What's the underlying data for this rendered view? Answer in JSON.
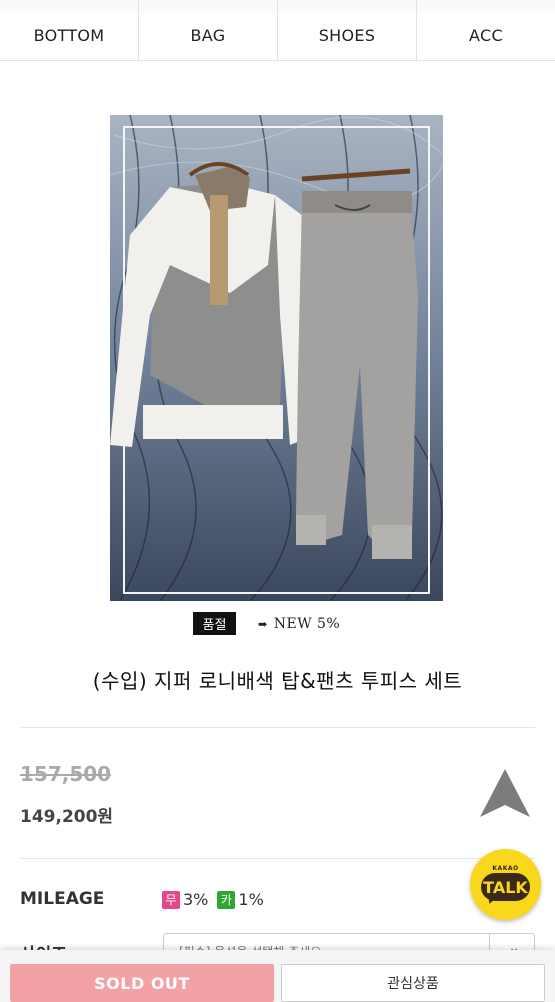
{
  "nav": {
    "items": [
      "BOTTOM",
      "BAG",
      "SHOES",
      "ACC"
    ]
  },
  "product": {
    "badge_soldout": "품절",
    "badge_new": "NEW 5%",
    "title": "(수입) 지퍼 로니배색 탑&팬츠 투피스 세트",
    "original_price": "157,500",
    "price": "149,200원"
  },
  "mileage": {
    "label": "MILEAGE",
    "items": [
      {
        "badge": "무",
        "value": "3%",
        "color": "#e5488a"
      },
      {
        "badge": "카",
        "value": "1%",
        "color": "#2fa832"
      }
    ]
  },
  "size": {
    "label": "사이즈",
    "placeholder": "[필수] 옵션을 선택해 주세요"
  },
  "kakao": {
    "small": "KAKAO",
    "label": "TALK"
  },
  "actions": {
    "soldout_label": "SOLD OUT",
    "wishlist_label": "관심상품"
  },
  "colors": {
    "soldout_button": "#f2a1a5",
    "kakao": "#f9d71c",
    "mileage_pink": "#e5488a",
    "mileage_green": "#2fa832"
  }
}
